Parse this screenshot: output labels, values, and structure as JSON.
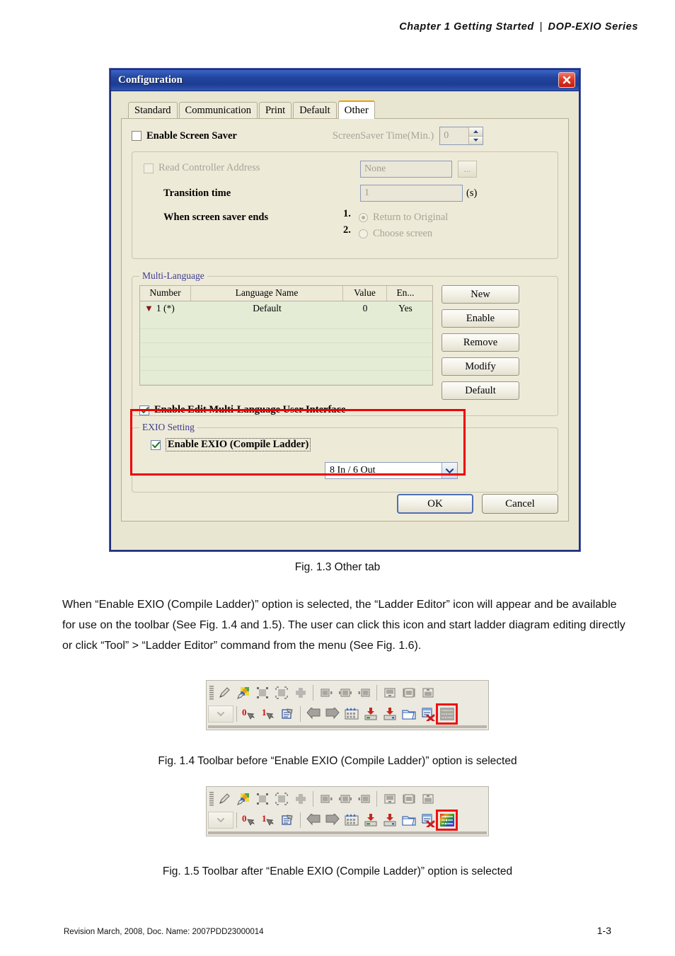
{
  "page": {
    "header": {
      "chapter": "Chapter 1  Getting  Started",
      "separator": "|",
      "series": "DOP-EXIO  Series"
    },
    "footer": {
      "revision": "Revision March, 2008, Doc. Name: 2007PDD23000014",
      "page_number": "1-3"
    },
    "captions": {
      "fig_1_3": "Fig. 1.3 Other tab",
      "fig_1_4": "Fig. 1.4 Toolbar before “Enable EXIO (Compile Ladder)” option is selected",
      "fig_1_5": "Fig. 1.5 Toolbar after “Enable EXIO (Compile Ladder)” option is selected"
    },
    "body_paragraph": "When “Enable EXIO (Compile Ladder)” option is selected, the “Ladder Editor” icon will appear and be available for use on the toolbar (See Fig. 1.4 and 1.5). The user can click this icon and start ladder diagram editing directly or click “Tool” > “Ladder Editor” command from the menu (See Fig. 1.6)."
  },
  "dialog": {
    "title": "Configuration",
    "close_icon": "close-icon",
    "tabs": [
      {
        "label": "Standard",
        "active": false
      },
      {
        "label": "Communication",
        "active": false
      },
      {
        "label": "Print",
        "active": false
      },
      {
        "label": "Default",
        "active": false
      },
      {
        "label": "Other",
        "active": true
      }
    ],
    "screen_saver": {
      "enable_label": "Enable Screen Saver",
      "enable_checked": false,
      "time_label": "ScreenSaver Time(Min.)",
      "time_value": "0",
      "read_controller_label": "Read Controller Address",
      "read_controller_checked": false,
      "address_value": "None",
      "browse_label": "...",
      "transition_label": "Transition time",
      "transition_value": "1",
      "transition_unit": "(s)",
      "ends_label": "When screen saver ends",
      "options": [
        {
          "number": "1.",
          "label": "Return to Original",
          "selected": true
        },
        {
          "number": "2.",
          "label": "Choose screen",
          "selected": false
        }
      ]
    },
    "multi_language": {
      "group_title": "Multi-Language",
      "columns": [
        "Number",
        "Language Name",
        "Value",
        "En..."
      ],
      "rows": [
        {
          "marker": "▼",
          "number": "1 (*)",
          "name": "Default",
          "value": "0",
          "enabled": "Yes"
        }
      ],
      "empty_rows": 5,
      "buttons": [
        "New",
        "Enable",
        "Remove",
        "Modify",
        "Default"
      ],
      "edit_ui_label": "Enable Edit Multi-Language User Interface",
      "edit_ui_checked": true
    },
    "exio": {
      "group_title": "EXIO Setting",
      "enable_label": "Enable EXIO (Compile Ladder)",
      "enable_checked": true,
      "io_selected": "8 In / 6 Out",
      "highlight_color": "#ee0000"
    },
    "buttons": {
      "ok": "OK",
      "cancel": "Cancel"
    }
  },
  "toolbars": {
    "before": {
      "ladder_editor_enabled": false,
      "row1_icons": [
        "grip-handle",
        "pen-tool-icon",
        "image-picker-icon",
        "select-shape-icon",
        "group-shape-icon",
        "node-shape-icon",
        "align-left-icon",
        "align-center-icon",
        "align-right-icon",
        "align-top-icon",
        "align-middle-icon",
        "align-bottom-icon"
      ],
      "row2_icons": [
        "dropdown-chevron-icon",
        "state-0-icon",
        "state-1-icon",
        "screen-properties-icon",
        "previous-screen-icon",
        "next-screen-icon",
        "keypad-icon",
        "download-icon",
        "upload-icon",
        "open-folder-icon",
        "delete-screen-icon",
        "ladder-editor-icon"
      ]
    },
    "after": {
      "ladder_editor_enabled": true,
      "row1_icons": [
        "grip-handle",
        "pen-tool-icon",
        "image-picker-icon",
        "select-shape-icon",
        "group-shape-icon",
        "node-shape-icon",
        "align-left-icon",
        "align-center-icon",
        "align-right-icon",
        "align-top-icon",
        "align-middle-icon",
        "align-bottom-icon"
      ],
      "row2_icons": [
        "dropdown-chevron-icon",
        "state-0-icon",
        "state-1-icon",
        "screen-properties-icon",
        "previous-screen-icon",
        "next-screen-icon",
        "keypad-icon",
        "download-icon",
        "upload-icon",
        "open-folder-icon",
        "delete-screen-icon",
        "ladder-editor-icon"
      ]
    }
  }
}
